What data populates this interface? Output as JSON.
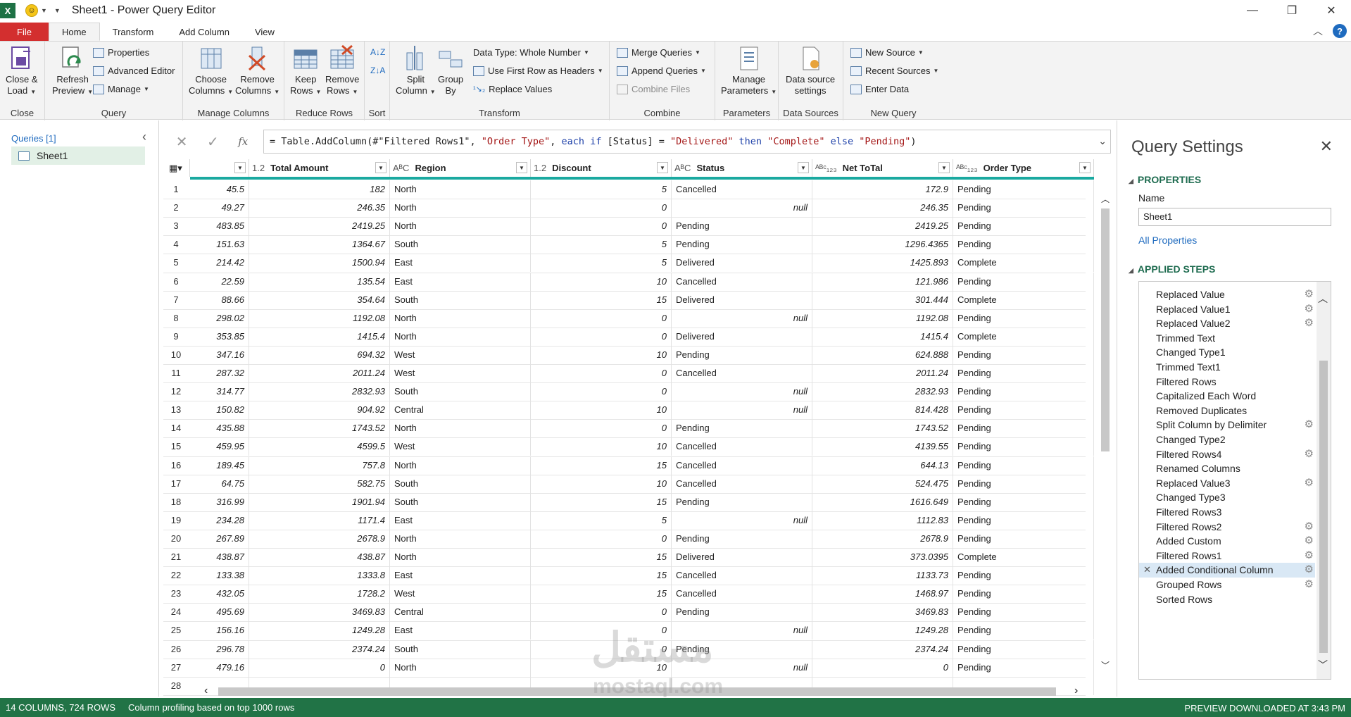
{
  "window": {
    "title": "Sheet1 - Power Query Editor"
  },
  "tabs": [
    "File",
    "Home",
    "Transform",
    "Add Column",
    "View"
  ],
  "ribbon": {
    "close": {
      "close_load": "Close &",
      "close_load2": "Load",
      "label": "Close"
    },
    "query": {
      "refresh": "Refresh",
      "refresh2": "Preview",
      "properties": "Properties",
      "advanced_editor": "Advanced Editor",
      "manage": "Manage",
      "label": "Query"
    },
    "manage_columns": {
      "choose": "Choose",
      "choose2": "Columns",
      "remove": "Remove",
      "remove2": "Columns",
      "label": "Manage Columns"
    },
    "reduce_rows": {
      "keep": "Keep",
      "keep2": "Rows",
      "remove": "Remove",
      "remove2": "Rows",
      "label": "Reduce Rows"
    },
    "sort": {
      "label": "Sort"
    },
    "transform": {
      "split": "Split",
      "split2": "Column",
      "group": "Group",
      "group2": "By",
      "data_type": "Data Type: Whole Number",
      "first_row": "Use First Row as Headers",
      "replace": "Replace Values",
      "label": "Transform"
    },
    "combine": {
      "merge": "Merge Queries",
      "append": "Append Queries",
      "combine_files": "Combine Files",
      "label": "Combine"
    },
    "parameters": {
      "manage": "Manage",
      "manage2": "Parameters",
      "label": "Parameters"
    },
    "data_sources": {
      "settings": "Data source",
      "settings2": "settings",
      "label": "Data Sources"
    },
    "new_query": {
      "new_source": "New Source",
      "recent": "Recent Sources",
      "enter": "Enter Data",
      "label": "New Query"
    }
  },
  "queries": {
    "title": "Queries [1]",
    "items": [
      "Sheet1"
    ]
  },
  "formula": {
    "prefix": "= Table.AddColumn(#\"Filtered Rows1\", ",
    "s1": "\"Order Type\"",
    "p2": ", ",
    "kw1": "each if",
    "p3": " [Status] = ",
    "s2": "\"Delivered\"",
    "kw2": " then ",
    "s3": "\"Complete\"",
    "kw3": " else ",
    "s4": "\"Pending\"",
    "p4": ")"
  },
  "columns": [
    {
      "name": "",
      "type": ""
    },
    {
      "name": "Total Amount",
      "type": "1.2"
    },
    {
      "name": "Region",
      "type": "ABC"
    },
    {
      "name": "Discount",
      "type": "1.2"
    },
    {
      "name": "Status",
      "type": "ABC"
    },
    {
      "name": "Net ToTal",
      "type": "ABC123"
    },
    {
      "name": "Order Type",
      "type": "ABC123"
    }
  ],
  "rows": [
    [
      "1",
      "45.5",
      "182",
      "North",
      "5",
      "Cancelled",
      "172.9",
      "Pending"
    ],
    [
      "2",
      "49.27",
      "246.35",
      "North",
      "0",
      "null",
      "246.35",
      "Pending"
    ],
    [
      "3",
      "483.85",
      "2419.25",
      "North",
      "0",
      "Pending",
      "2419.25",
      "Pending"
    ],
    [
      "4",
      "151.63",
      "1364.67",
      "South",
      "5",
      "Pending",
      "1296.4365",
      "Pending"
    ],
    [
      "5",
      "214.42",
      "1500.94",
      "East",
      "5",
      "Delivered",
      "1425.893",
      "Complete"
    ],
    [
      "6",
      "22.59",
      "135.54",
      "East",
      "10",
      "Cancelled",
      "121.986",
      "Pending"
    ],
    [
      "7",
      "88.66",
      "354.64",
      "South",
      "15",
      "Delivered",
      "301.444",
      "Complete"
    ],
    [
      "8",
      "298.02",
      "1192.08",
      "North",
      "0",
      "null",
      "1192.08",
      "Pending"
    ],
    [
      "9",
      "353.85",
      "1415.4",
      "North",
      "0",
      "Delivered",
      "1415.4",
      "Complete"
    ],
    [
      "10",
      "347.16",
      "694.32",
      "West",
      "10",
      "Pending",
      "624.888",
      "Pending"
    ],
    [
      "11",
      "287.32",
      "2011.24",
      "West",
      "0",
      "Cancelled",
      "2011.24",
      "Pending"
    ],
    [
      "12",
      "314.77",
      "2832.93",
      "South",
      "0",
      "null",
      "2832.93",
      "Pending"
    ],
    [
      "13",
      "150.82",
      "904.92",
      "Central",
      "10",
      "null",
      "814.428",
      "Pending"
    ],
    [
      "14",
      "435.88",
      "1743.52",
      "North",
      "0",
      "Pending",
      "1743.52",
      "Pending"
    ],
    [
      "15",
      "459.95",
      "4599.5",
      "West",
      "10",
      "Cancelled",
      "4139.55",
      "Pending"
    ],
    [
      "16",
      "189.45",
      "757.8",
      "North",
      "15",
      "Cancelled",
      "644.13",
      "Pending"
    ],
    [
      "17",
      "64.75",
      "582.75",
      "South",
      "10",
      "Cancelled",
      "524.475",
      "Pending"
    ],
    [
      "18",
      "316.99",
      "1901.94",
      "South",
      "15",
      "Pending",
      "1616.649",
      "Pending"
    ],
    [
      "19",
      "234.28",
      "1171.4",
      "East",
      "5",
      "null",
      "1112.83",
      "Pending"
    ],
    [
      "20",
      "267.89",
      "2678.9",
      "North",
      "0",
      "Pending",
      "2678.9",
      "Pending"
    ],
    [
      "21",
      "438.87",
      "438.87",
      "North",
      "15",
      "Delivered",
      "373.0395",
      "Complete"
    ],
    [
      "22",
      "133.38",
      "1333.8",
      "East",
      "15",
      "Cancelled",
      "1133.73",
      "Pending"
    ],
    [
      "23",
      "432.05",
      "1728.2",
      "West",
      "15",
      "Cancelled",
      "1468.97",
      "Pending"
    ],
    [
      "24",
      "495.69",
      "3469.83",
      "Central",
      "0",
      "Pending",
      "3469.83",
      "Pending"
    ],
    [
      "25",
      "156.16",
      "1249.28",
      "East",
      "0",
      "null",
      "1249.28",
      "Pending"
    ],
    [
      "26",
      "296.78",
      "2374.24",
      "South",
      "0",
      "Pending",
      "2374.24",
      "Pending"
    ],
    [
      "27",
      "479.16",
      "0",
      "North",
      "10",
      "null",
      "0",
      "Pending"
    ],
    [
      "28",
      "",
      "",
      "",
      "",
      "",
      "",
      ""
    ]
  ],
  "query_settings": {
    "title": "Query Settings",
    "properties_label": "PROPERTIES",
    "name_label": "Name",
    "name_value": "Sheet1",
    "all_properties": "All Properties",
    "applied_steps_label": "APPLIED STEPS",
    "steps": [
      {
        "name": "Replaced Value",
        "gear": true
      },
      {
        "name": "Replaced Value1",
        "gear": true
      },
      {
        "name": "Replaced Value2",
        "gear": true
      },
      {
        "name": "Trimmed Text",
        "gear": false
      },
      {
        "name": "Changed Type1",
        "gear": false
      },
      {
        "name": "Trimmed Text1",
        "gear": false
      },
      {
        "name": "Filtered Rows",
        "gear": false
      },
      {
        "name": "Capitalized Each Word",
        "gear": false
      },
      {
        "name": "Removed Duplicates",
        "gear": false
      },
      {
        "name": "Split Column by Delimiter",
        "gear": true
      },
      {
        "name": "Changed Type2",
        "gear": false
      },
      {
        "name": "Filtered Rows4",
        "gear": true
      },
      {
        "name": "Renamed Columns",
        "gear": false
      },
      {
        "name": "Replaced Value3",
        "gear": true
      },
      {
        "name": "Changed Type3",
        "gear": false
      },
      {
        "name": "Filtered Rows3",
        "gear": false
      },
      {
        "name": "Filtered Rows2",
        "gear": true
      },
      {
        "name": "Added Custom",
        "gear": true
      },
      {
        "name": "Filtered Rows1",
        "gear": true
      },
      {
        "name": "Added Conditional Column",
        "gear": true,
        "selected": true
      },
      {
        "name": "Grouped Rows",
        "gear": true
      },
      {
        "name": "Sorted Rows",
        "gear": false
      }
    ]
  },
  "status": {
    "left": "14 COLUMNS, 724 ROWS",
    "profiling": "Column profiling based on top 1000 rows",
    "right": "PREVIEW DOWNLOADED AT 3:43 PM"
  },
  "watermark": {
    "ar": "مستقل",
    "en": "mostaql.com"
  },
  "colors": {
    "accent": "#217346",
    "quality_bar": "#1aa9a0",
    "file_tab": "#d32f2f"
  }
}
